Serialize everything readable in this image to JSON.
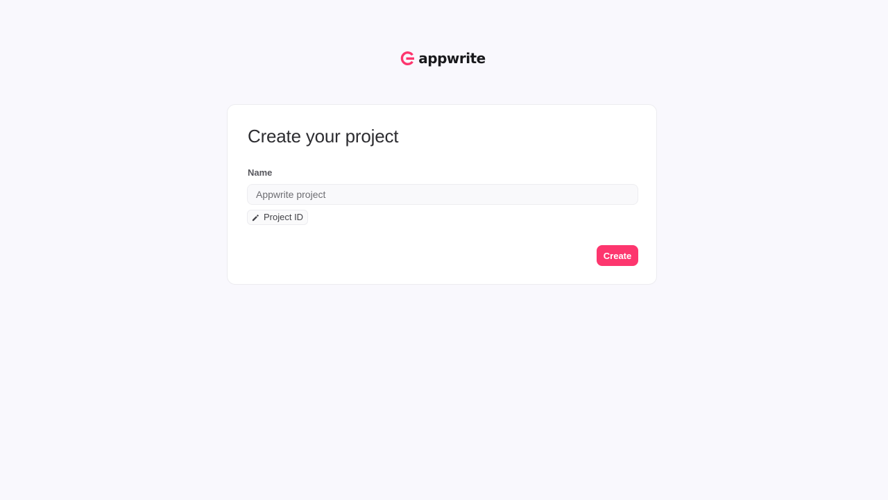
{
  "brand": {
    "name": "appwrite",
    "logo_icon": "appwrite-logo-icon",
    "accent_color": "#fd366e"
  },
  "form": {
    "title": "Create your project",
    "name_label": "Name",
    "name_value": "",
    "name_placeholder": "Appwrite project",
    "project_id_tag": {
      "icon": "pencil-icon",
      "label": "Project ID"
    },
    "submit_label": "Create"
  },
  "colors": {
    "background": "#f9f8fd",
    "card": "#ffffff",
    "button": "#fd366e",
    "text": "#2d2d31"
  }
}
